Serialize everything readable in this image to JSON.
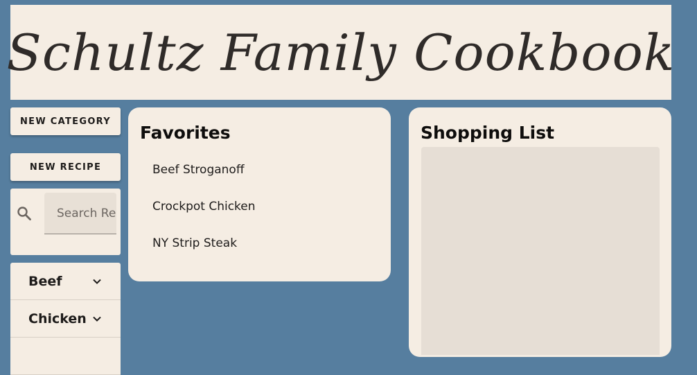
{
  "header": {
    "title": "Schultz Family Cookbook"
  },
  "sidebar": {
    "new_category_label": "NEW CATEGORY",
    "new_recipe_label": "NEW RECIPE",
    "search": {
      "placeholder": "Search Recipes",
      "icon": "search-icon"
    },
    "categories": [
      {
        "label": "Beef",
        "icon": "chevron-down-icon"
      },
      {
        "label": "Chicken",
        "icon": "chevron-down-icon"
      }
    ]
  },
  "favorites": {
    "title": "Favorites",
    "items": [
      "Beef Stroganoff",
      "Crockpot Chicken",
      "NY Strip Steak"
    ]
  },
  "shopping_list": {
    "title": "Shopping List",
    "value": ""
  },
  "colors": {
    "background": "#567e9f",
    "card": "#f5ede3",
    "input": "#e8e0d6"
  }
}
